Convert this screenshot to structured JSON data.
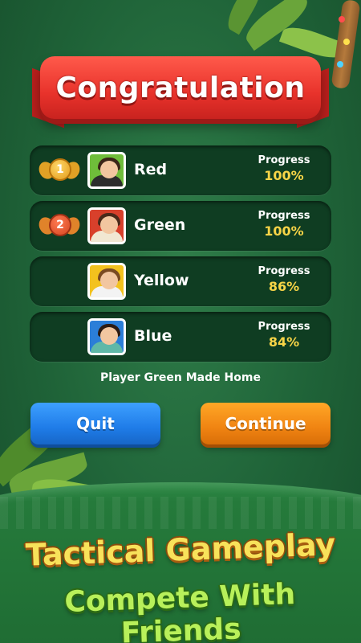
{
  "banner": {
    "title": "Congratulation"
  },
  "players": [
    {
      "rank": "1",
      "name": "Red",
      "progress_label": "Progress",
      "progress": "100%"
    },
    {
      "rank": "2",
      "name": "Green",
      "progress_label": "Progress",
      "progress": "100%"
    },
    {
      "rank": "",
      "name": "Yellow",
      "progress_label": "Progress",
      "progress": "86%"
    },
    {
      "rank": "",
      "name": "Blue",
      "progress_label": "Progress",
      "progress": "84%"
    }
  ],
  "status_message": "Player Green Made Home",
  "buttons": {
    "quit": "Quit",
    "continue": "Continue"
  },
  "taglines": {
    "line1": "Tactical Gameplay",
    "line2": "Compete With Friends"
  },
  "colors": {
    "quit": "#1f7ce8",
    "continue": "#f08412",
    "banner": "#e8322b",
    "progress_value": "#f7d447"
  }
}
